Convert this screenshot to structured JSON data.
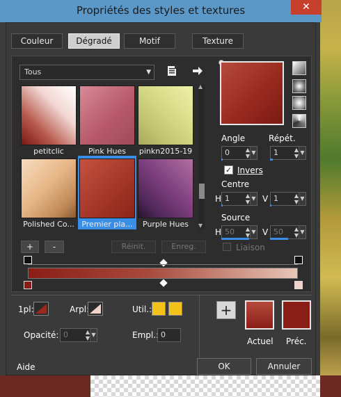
{
  "window": {
    "title": "Propriétés des styles et textures",
    "close_label": "✕"
  },
  "tabs": [
    "Couleur",
    "Dégradé",
    "Motif",
    "Texture"
  ],
  "library": {
    "category": "Tous",
    "gradients": [
      {
        "name": "petitclic"
      },
      {
        "name": "Pink Hues"
      },
      {
        "name": "pinkn2015-19"
      },
      {
        "name": "Polished Co..."
      },
      {
        "name": "Premier pla..."
      },
      {
        "name": "Purple Hues"
      }
    ],
    "add_label": "+",
    "remove_label": "-",
    "reset_label": "Réinit.",
    "save_label": "Enreg."
  },
  "settings": {
    "angle_label": "Angle",
    "angle_value": "0",
    "repeat_label": "Répét.",
    "repeat_value": "1",
    "invert_label": "Invers",
    "center_label": "Centre",
    "center_h_label": "H",
    "center_h": "1",
    "center_v_label": "V",
    "center_v": "1",
    "source_label": "Source",
    "source_h_label": "H",
    "source_h": "50",
    "source_v_label": "V",
    "source_v": "50",
    "link_label": "Liaison"
  },
  "editor": {
    "premier_plan_label": "1pl:",
    "arriere_plan_label": "Arpl:",
    "util_label": "Util.:",
    "opacity_label": "Opacité:",
    "opacity_value": "0",
    "empl_label": "Empl.:",
    "empl_value": "0",
    "util_color": "#f2c21a"
  },
  "current": {
    "add_label": "+",
    "actuel_label": "Actuel",
    "prec_label": "Préc."
  },
  "footer": {
    "help_label": "Aide",
    "ok_label": "OK",
    "cancel_label": "Annuler"
  },
  "colors": {
    "accent": "#3a8ee6",
    "titlebar": "#5b98c8",
    "gradient_dark": "#8a1e16",
    "gradient_light": "#e8c6b8"
  }
}
